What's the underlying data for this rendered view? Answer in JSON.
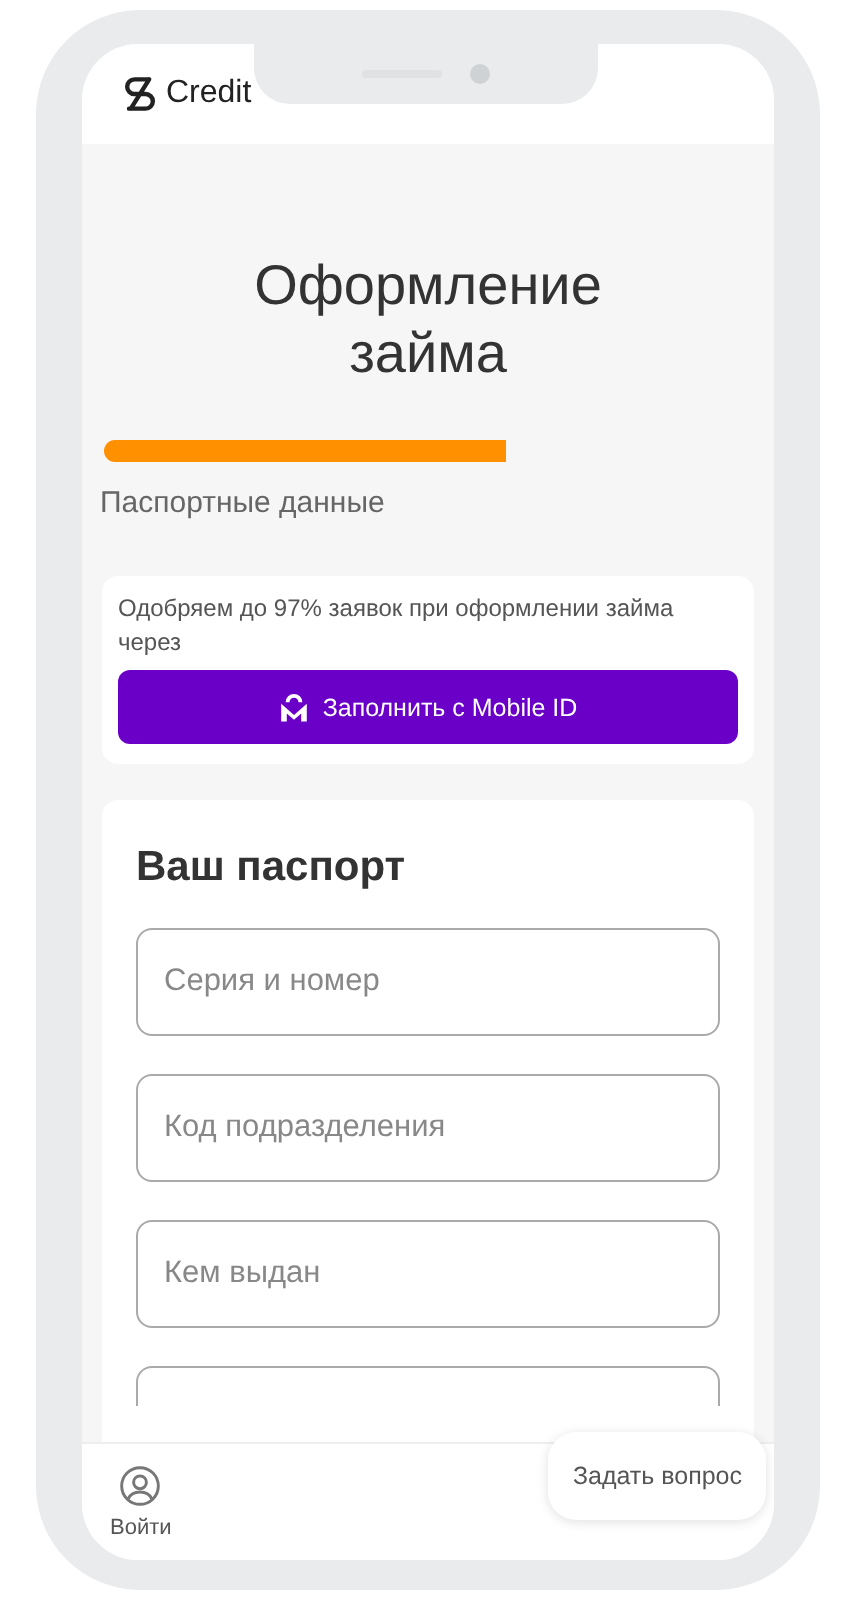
{
  "header": {
    "logo": "Credit"
  },
  "title": "Оформление займа",
  "progress": {
    "label": "Паспортные данные"
  },
  "promo": {
    "text": "Одобряем до 97% заявок при оформлении займа через",
    "button": "Заполнить с Mobile ID"
  },
  "passport": {
    "heading": "Ваш паспорт",
    "fields": [
      {
        "placeholder": "Серия и номер"
      },
      {
        "placeholder": "Код подразделения"
      },
      {
        "placeholder": "Кем выдан"
      }
    ]
  },
  "bottom_bar": {
    "login": "Войти",
    "ask": "Задать вопрос"
  }
}
